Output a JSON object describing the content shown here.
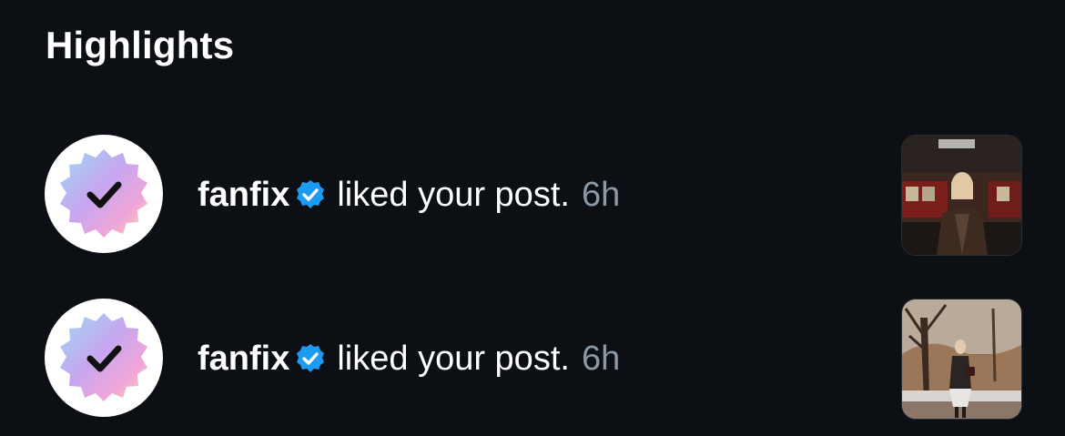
{
  "header": {
    "title": "Highlights"
  },
  "notifications": [
    {
      "username": "fanfix",
      "verified_icon": "verified-badge-icon",
      "action": "liked your post.",
      "time": "6h",
      "avatar_icon": "checkmark-icon",
      "thumbnail": "subway-photo"
    },
    {
      "username": "fanfix",
      "verified_icon": "verified-badge-icon",
      "action": "liked your post.",
      "time": "6h",
      "avatar_icon": "checkmark-icon",
      "thumbnail": "park-photo"
    }
  ],
  "colors": {
    "background": "#0c0f14",
    "text": "#ffffff",
    "muted": "#8b98a5",
    "verified": "#1d9bf0"
  }
}
